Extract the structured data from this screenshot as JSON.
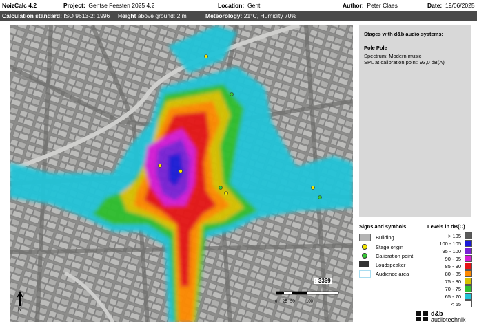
{
  "header": {
    "app": "NoizCalc 4.2",
    "project_label": "Project:",
    "project": "Gentse Feesten 2025 4.2",
    "location_label": "Location:",
    "location": "Gent",
    "author_label": "Author:",
    "author": "Peter Claes",
    "date_label": "Date:",
    "date": "19/06/2025"
  },
  "subheader": {
    "standard_label": "Calculation standard:",
    "standard": "ISO 9613-2: 1996",
    "height_label": "Height",
    "height_suffix": "above ground:",
    "height": "2 m",
    "met_label": "Meteorology:",
    "met": "21°C, Humidity 70%"
  },
  "side": {
    "stages_title": "Stages with d&b audio systems:",
    "system_name": "Pole Pole",
    "spectrum": "Spectrum:  Modern music",
    "spl": "SPL at calibration point:  93,0 dB(A)"
  },
  "symbols": {
    "title": "Signs and symbols",
    "items": [
      {
        "label": "Building",
        "color": "#b4b4b4"
      },
      {
        "label": "Stage origin",
        "color": "#f2e600"
      },
      {
        "label": "Calibration point",
        "color": "#33c633"
      },
      {
        "label": "Loudspeaker",
        "color": "#333333"
      },
      {
        "label": "Audience area",
        "color": "#a8dcf0"
      }
    ]
  },
  "levels": {
    "title": "Levels in dB(C)",
    "items": [
      {
        "label": "> 105",
        "color": "#5a5a5a"
      },
      {
        "label": "100 - 105",
        "color": "#1a1ad8"
      },
      {
        "label": "95 - 100",
        "color": "#7a22d6"
      },
      {
        "label": "90 - 95",
        "color": "#d61ed6"
      },
      {
        "label": "85 - 90",
        "color": "#e61414"
      },
      {
        "label": "80 - 85",
        "color": "#ff8a00"
      },
      {
        "label": "75 - 80",
        "color": "#d8c200"
      },
      {
        "label": "70 - 75",
        "color": "#2fbf2f"
      },
      {
        "label": "65 - 70",
        "color": "#22c4d8"
      },
      {
        "label": "< 65",
        "color": "#ffffff"
      }
    ]
  },
  "map": {
    "scale_ratio": ": 3369",
    "scale_ticks": [
      "0",
      "25",
      "50",
      "100"
    ],
    "north": "N"
  },
  "logo": {
    "line1": "d&b",
    "line2": "audiotechnik"
  }
}
